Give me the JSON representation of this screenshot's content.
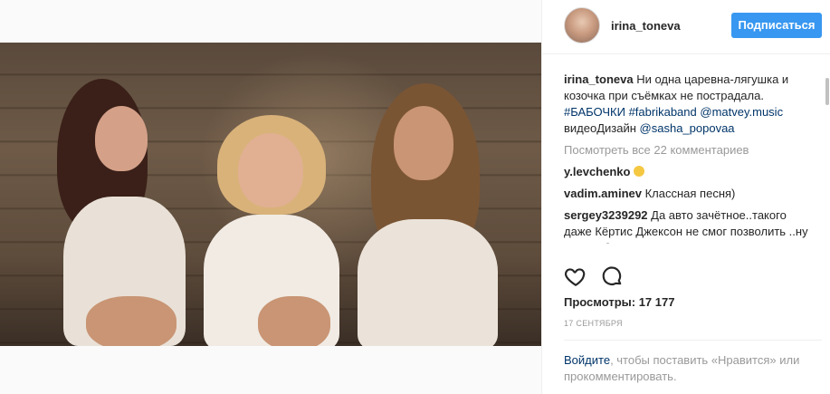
{
  "post": {
    "username": "irina_toneva",
    "follow_label": "Подписаться",
    "caption": {
      "author": "irina_toneva",
      "text": " Ни одна царевна-лягушка и козочка при съёмках не пострадала. ",
      "hashtag1": "#БАБОЧКИ",
      "hashtag2": "#fabrikaband",
      "mention1": "@matvey.music",
      "text2": " видеоДизайн ",
      "mention2": "@sasha_popovaa"
    },
    "view_all": "Посмотреть все 22 комментариев",
    "comments": [
      {
        "author": "y.levchenko",
        "text": " "
      },
      {
        "author": "vadim.aminev",
        "text": " Классная песня)"
      },
      {
        "author": "sergey3239292",
        "text": " Да авто зачётное..такого даже Кёртис Джексон не смог позволить ..ну а если без шуток ..клёвая песня и"
      }
    ],
    "views_label": "Просмотры: 17 177",
    "date": "17 СЕНТЯБРЯ",
    "login_link": "Войдите",
    "login_text": ", чтобы поставить «Нравится» или прокомментировать."
  },
  "icons": {
    "like": "heart-icon",
    "comment": "comment-bubble-icon"
  },
  "colors": {
    "accent": "#3897f0",
    "link": "#003569",
    "muted": "#999999"
  }
}
